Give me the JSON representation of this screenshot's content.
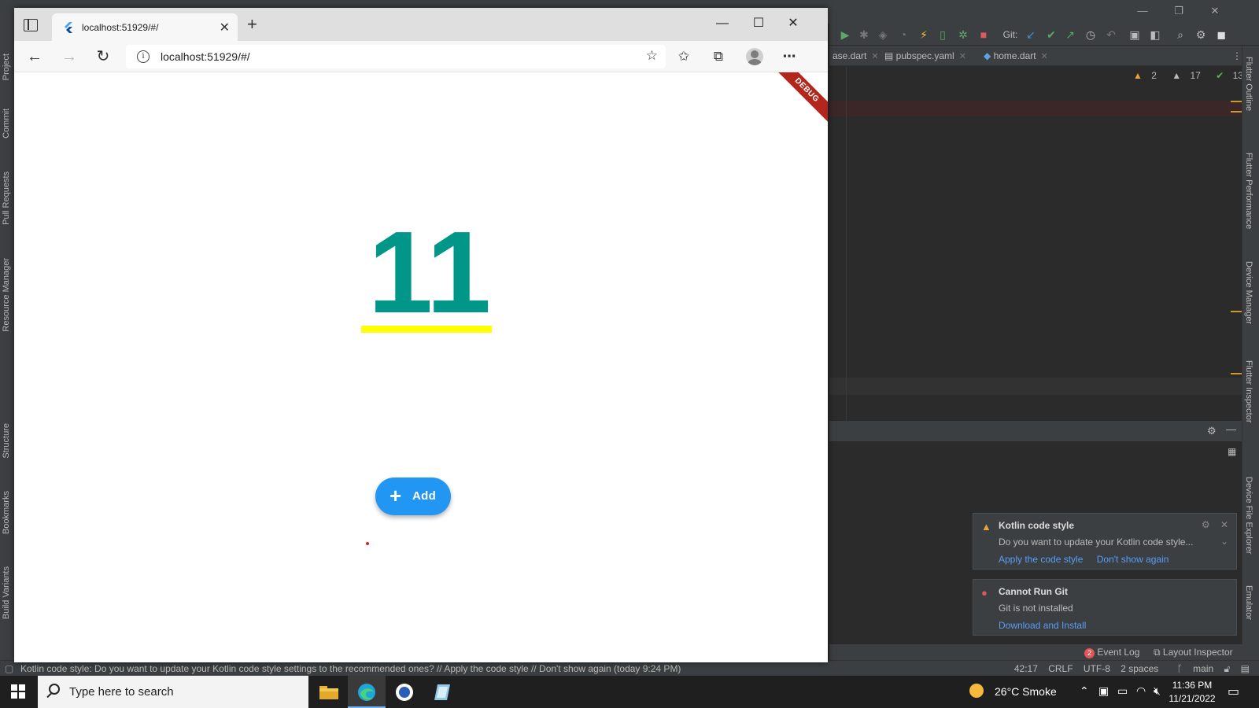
{
  "ide": {
    "tabs": [
      {
        "label": "ase.dart"
      },
      {
        "label": "pubspec.yaml"
      },
      {
        "label": "home.dart"
      }
    ],
    "git_label": "Git:",
    "inspections": {
      "warnings": "2",
      "weak_warnings": "17",
      "ok": "13"
    },
    "right_tools": [
      "Flutter Outline",
      "Flutter Performance",
      "Device Manager",
      "Flutter Inspector",
      "Device File Explorer",
      "Emulator"
    ],
    "left_tools": [
      "Project",
      "Commit",
      "Pull Requests",
      "Resource Manager",
      "Structure",
      "Bookmarks",
      "Build Variants"
    ],
    "notifications": [
      {
        "title": "Kotlin code style",
        "body": "Do you want to update your Kotlin code style...",
        "actions": [
          "Apply the code style",
          "Don't show again"
        ]
      },
      {
        "title": "Cannot Run Git",
        "body": "Git is not installed",
        "actions": [
          "Download and Install"
        ]
      }
    ],
    "tool_status": {
      "event_log_count": "2",
      "event_log": "Event Log",
      "layout_inspector": "Layout Inspector"
    },
    "status_message": "Kotlin code style: Do you want to update your Kotlin code style settings to the recommended ones? // Apply the code style // Don't show again (today 9:24 PM)",
    "status_right": {
      "position": "42:17",
      "line_sep": "CRLF",
      "encoding": "UTF-8",
      "indent": "2 spaces",
      "branch": "main"
    }
  },
  "browser": {
    "tab_title": "localhost:51929/#/",
    "address": "localhost:51929/#/"
  },
  "app": {
    "debug_banner": "DEBUG",
    "counter": "11",
    "add_button_label": "Add",
    "counter_color": "#009688",
    "underline_color": "#ffff00",
    "button_color": "#2196f3"
  },
  "taskbar": {
    "search_placeholder": "Type here to search",
    "weather": "26°C  Smoke",
    "time": "11:36 PM",
    "date": "11/21/2022"
  }
}
